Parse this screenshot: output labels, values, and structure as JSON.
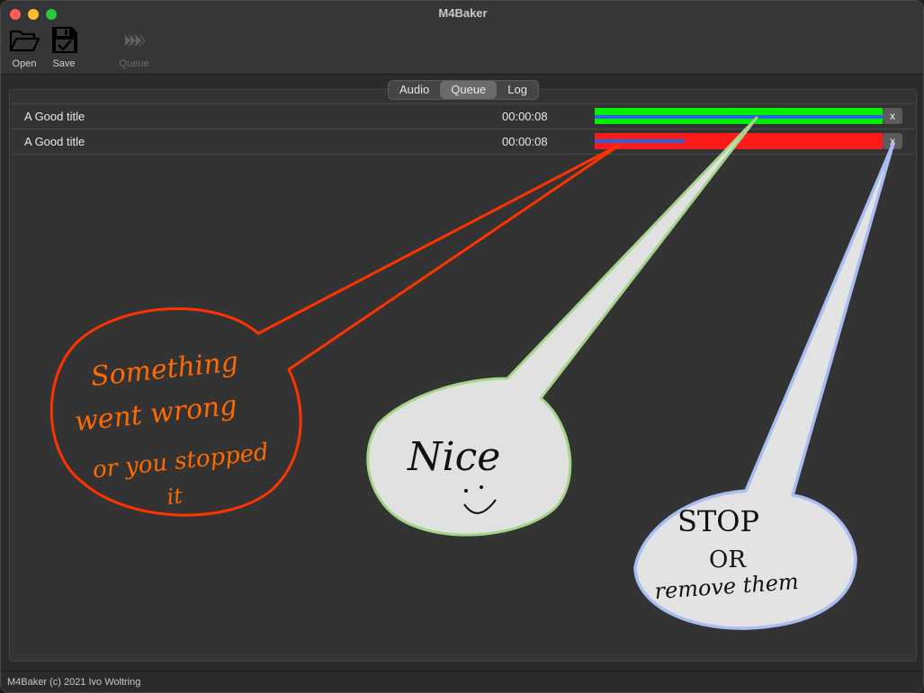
{
  "window": {
    "title": "M4Baker"
  },
  "toolbar": {
    "open_label": "Open",
    "save_label": "Save",
    "queue_label": "Queue"
  },
  "tabs": [
    {
      "label": "Audio",
      "active": false
    },
    {
      "label": "Queue",
      "active": true
    },
    {
      "label": "Log",
      "active": false
    }
  ],
  "queue_items": [
    {
      "title": "A Good title",
      "duration": "00:00:08",
      "status": "complete",
      "progress": 1.0,
      "bar_color": "#00ee00",
      "remove_label": "x"
    },
    {
      "title": "A Good title",
      "duration": "00:00:08",
      "status": "failed",
      "progress": 0.3,
      "bar_color": "#ff1a1a",
      "remove_label": "x"
    }
  ],
  "annotations": {
    "red_note": [
      "Something",
      "went wrong",
      "or you stopped",
      "it"
    ],
    "green_note": [
      "Nice"
    ],
    "blue_note": [
      "STOP",
      "OR",
      "remove them"
    ]
  },
  "status_bar": {
    "text": "M4Baker (c) 2021 Ivo Woltring"
  },
  "colors": {
    "success": "#00ee00",
    "error": "#ff1a1a",
    "progress": "#2a62e0",
    "note_red": "#ff3300",
    "note_green": "#a6d58a",
    "note_blue": "#a9bdf2"
  }
}
